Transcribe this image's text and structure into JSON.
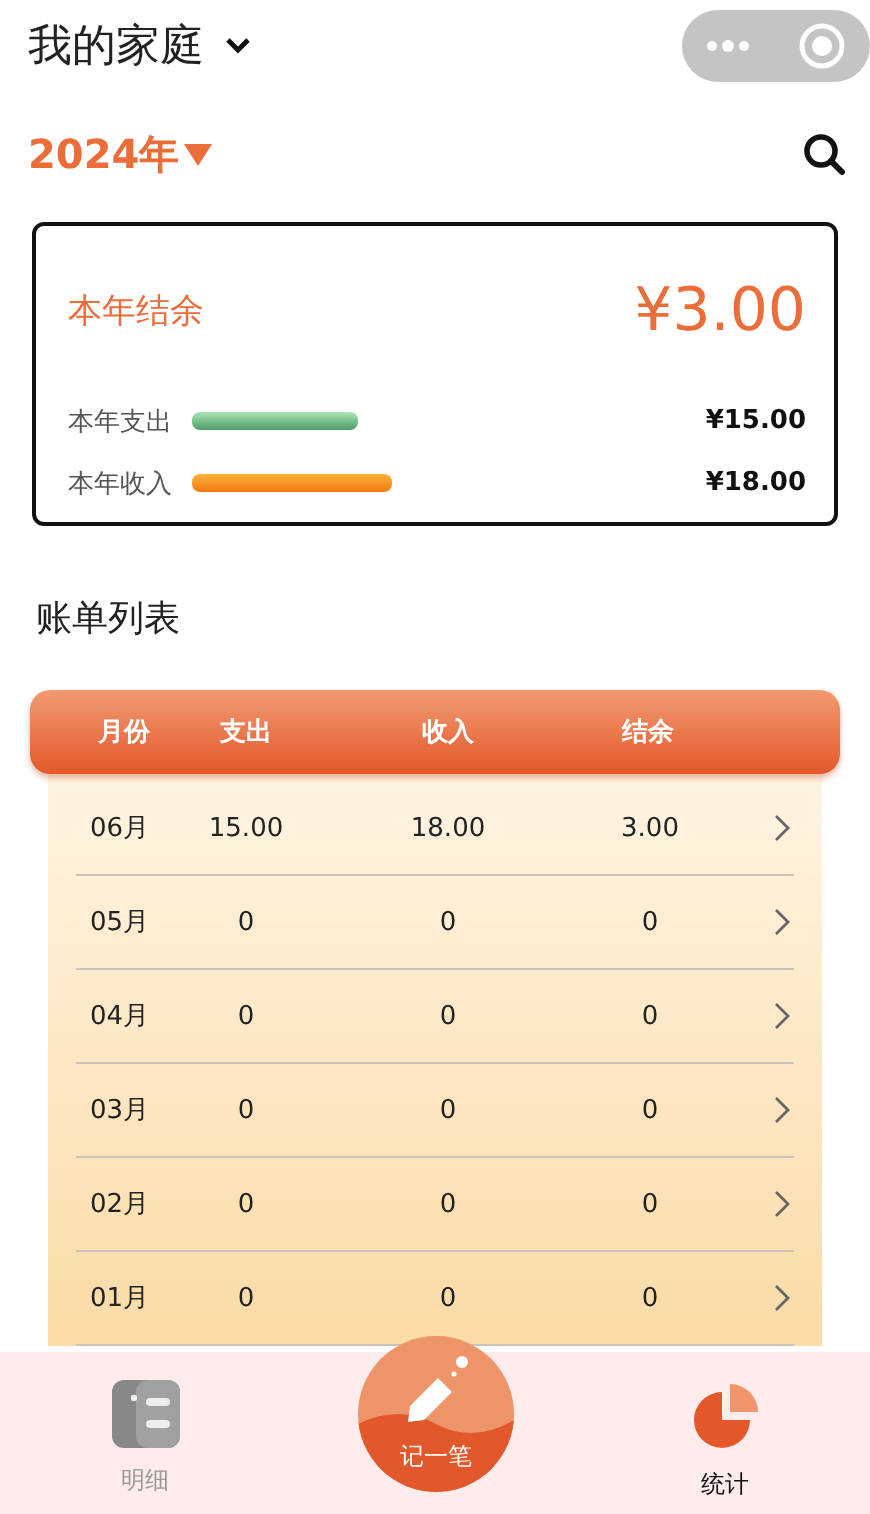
{
  "header": {
    "title": "我的家庭"
  },
  "year": {
    "label": "2024年"
  },
  "summary": {
    "label": "本年结余",
    "amount": "¥3.00",
    "lines": [
      {
        "label": "本年支出",
        "amount": "¥15.00",
        "kind": "expense"
      },
      {
        "label": "本年收入",
        "amount": "¥18.00",
        "kind": "income"
      }
    ]
  },
  "section_title": "账单列表",
  "table": {
    "columns": [
      "月份",
      "支出",
      "收入",
      "结余"
    ],
    "rows": [
      [
        "06月",
        "15.00",
        "18.00",
        "3.00"
      ],
      [
        "05月",
        "0",
        "0",
        "0"
      ],
      [
        "04月",
        "0",
        "0",
        "0"
      ],
      [
        "03月",
        "0",
        "0",
        "0"
      ],
      [
        "02月",
        "0",
        "0",
        "0"
      ],
      [
        "01月",
        "0",
        "0",
        "0"
      ]
    ]
  },
  "tabbar": {
    "items": [
      {
        "label": "明细",
        "selected": false,
        "kind": "list"
      },
      {
        "label": "记一笔",
        "selected": false,
        "kind": "add"
      },
      {
        "label": "统计",
        "selected": true,
        "kind": "stats"
      }
    ]
  }
}
